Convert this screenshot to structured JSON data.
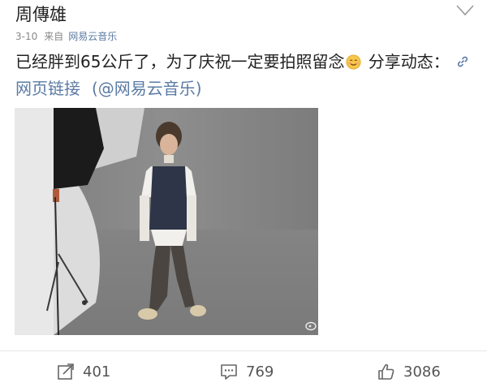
{
  "post": {
    "author": "周傳雄",
    "date": "3-10",
    "from_label": "来自",
    "source": "网易云音乐",
    "text_part1": "已经胖到65公斤了，为了庆祝一定要拍照留念",
    "text_part2": " 分享动态：",
    "link_text": "网页链接",
    "mention_text": "(@网易云音乐)"
  },
  "actions": {
    "repost_count": "401",
    "comment_count": "769",
    "like_count": "3086"
  },
  "icons": [
    "chevron-down-icon",
    "smile-emoji-icon",
    "link-icon",
    "weibo-watermark-icon",
    "repost-icon",
    "comment-icon",
    "thumbs-up-icon"
  ],
  "colors": {
    "link": "#5b7ba3",
    "meta": "#888888",
    "text": "#222222"
  }
}
